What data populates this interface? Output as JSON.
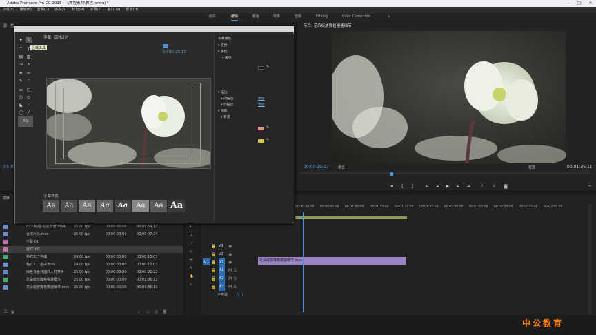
{
  "app": {
    "title": "Adobe Premiere Pro CC 2015 - I:\\教程素材\\教程.prproj *"
  },
  "menu": [
    "文件(F)",
    "编辑(E)",
    "剪辑(C)",
    "序列(S)",
    "标记(M)",
    "字幕(T)",
    "窗口(W)",
    "帮助(H)"
  ],
  "workspaces": [
    "组件",
    "编辑",
    "颜色",
    "效果",
    "音频",
    "Editing",
    "Color Correction"
  ],
  "active_workspace": "编辑",
  "source_panel": {
    "tab": "源：花…",
    "timecode": "00:00:00:00"
  },
  "program": {
    "tab": "节目: 花朵绽放降格慢速细节",
    "timecode": "00:00:29:17",
    "fit": "适合",
    "quality": "完整",
    "duration": "00:01:36:11"
  },
  "title_dialog": {
    "header": "字幕: 延时计时",
    "timecode": "00:00:29:17",
    "tooltip": "区域工具",
    "styles_header": "字幕样式",
    "props_header": "字幕属性",
    "styles": [
      "Aa",
      "Aa",
      "Aa",
      "Aa",
      "Aa",
      "Aa",
      "Aa",
      "Aa"
    ],
    "properties": [
      {
        "label": "变换",
        "kind": "tri"
      },
      {
        "label": "属性",
        "kind": "tri"
      },
      {
        "label": "填充",
        "kind": "tri"
      },
      {
        "label": "描边",
        "kind": "tri"
      },
      {
        "label": "内描边",
        "kind": "link",
        "link": "添加"
      },
      {
        "label": "外描边",
        "kind": "link",
        "link": "添加"
      },
      {
        "label": "阴影",
        "kind": "tri"
      },
      {
        "label": "背景",
        "kind": "tri"
      }
    ]
  },
  "project": {
    "items": [
      {
        "name": "H22-助理-动态背景.mp4",
        "fps": "25.00 fps",
        "start": "00:00:00:00",
        "dur": "00:01:54:17",
        "color": "#6b8cd6"
      },
      {
        "name": "合成片段.mov",
        "fps": "25.00 fps",
        "start": "00:00:00:00",
        "dur": "00:00:07:24",
        "color": "#6b8cd6"
      },
      {
        "name": "字幕 01",
        "fps": "",
        "start": "",
        "dur": "",
        "color": "#c86fb8"
      },
      {
        "name": "延时计时",
        "fps": "",
        "start": "",
        "dur": "",
        "color": "#c86fb8"
      },
      {
        "name": "格式工厂自由",
        "fps": "24.00 fps",
        "start": "00:00:00:00",
        "dur": "00:00:10:07",
        "color": "#3bb36b"
      },
      {
        "name": "格式工厂自由.mov",
        "fps": "24.00 fps",
        "start": "00:00:00:00",
        "dur": "00:00:10:07",
        "color": "#6b8cd6"
      },
      {
        "name": "绿色背景外国商人打开手",
        "fps": "25.00 fps",
        "start": "00:00:00:00",
        "dur": "00:00:21:22",
        "color": "#6b8cd6"
      },
      {
        "name": "花朵绽放降格慢速细节",
        "fps": "25.00 fps",
        "start": "00:00:00:00",
        "dur": "00:01:36:11",
        "color": "#3bb36b"
      },
      {
        "name": "花朵绽放降格慢速细节.mov",
        "fps": "25.00 fps",
        "start": "00:00:00:00",
        "dur": "00:01:36:11",
        "color": "#6b8cd6"
      }
    ]
  },
  "timeline": {
    "ticks": [
      "00:00:30:00",
      "00:00:45:00",
      "00:01:00:00",
      "00:01:15:00",
      "00:01:30:00",
      "00:01:45:00",
      "00:02:00:00",
      "00:02:15:00",
      "00:02:30:00",
      "00:02:45:00",
      "00:03:00:00"
    ],
    "tracks": [
      "V3",
      "V2",
      "V1",
      "A1",
      "A2",
      "A3",
      "主声道"
    ],
    "master_value": "0.0",
    "clip_label": "花朵绽放降格慢速细节.mov"
  },
  "logo": "中公教育"
}
